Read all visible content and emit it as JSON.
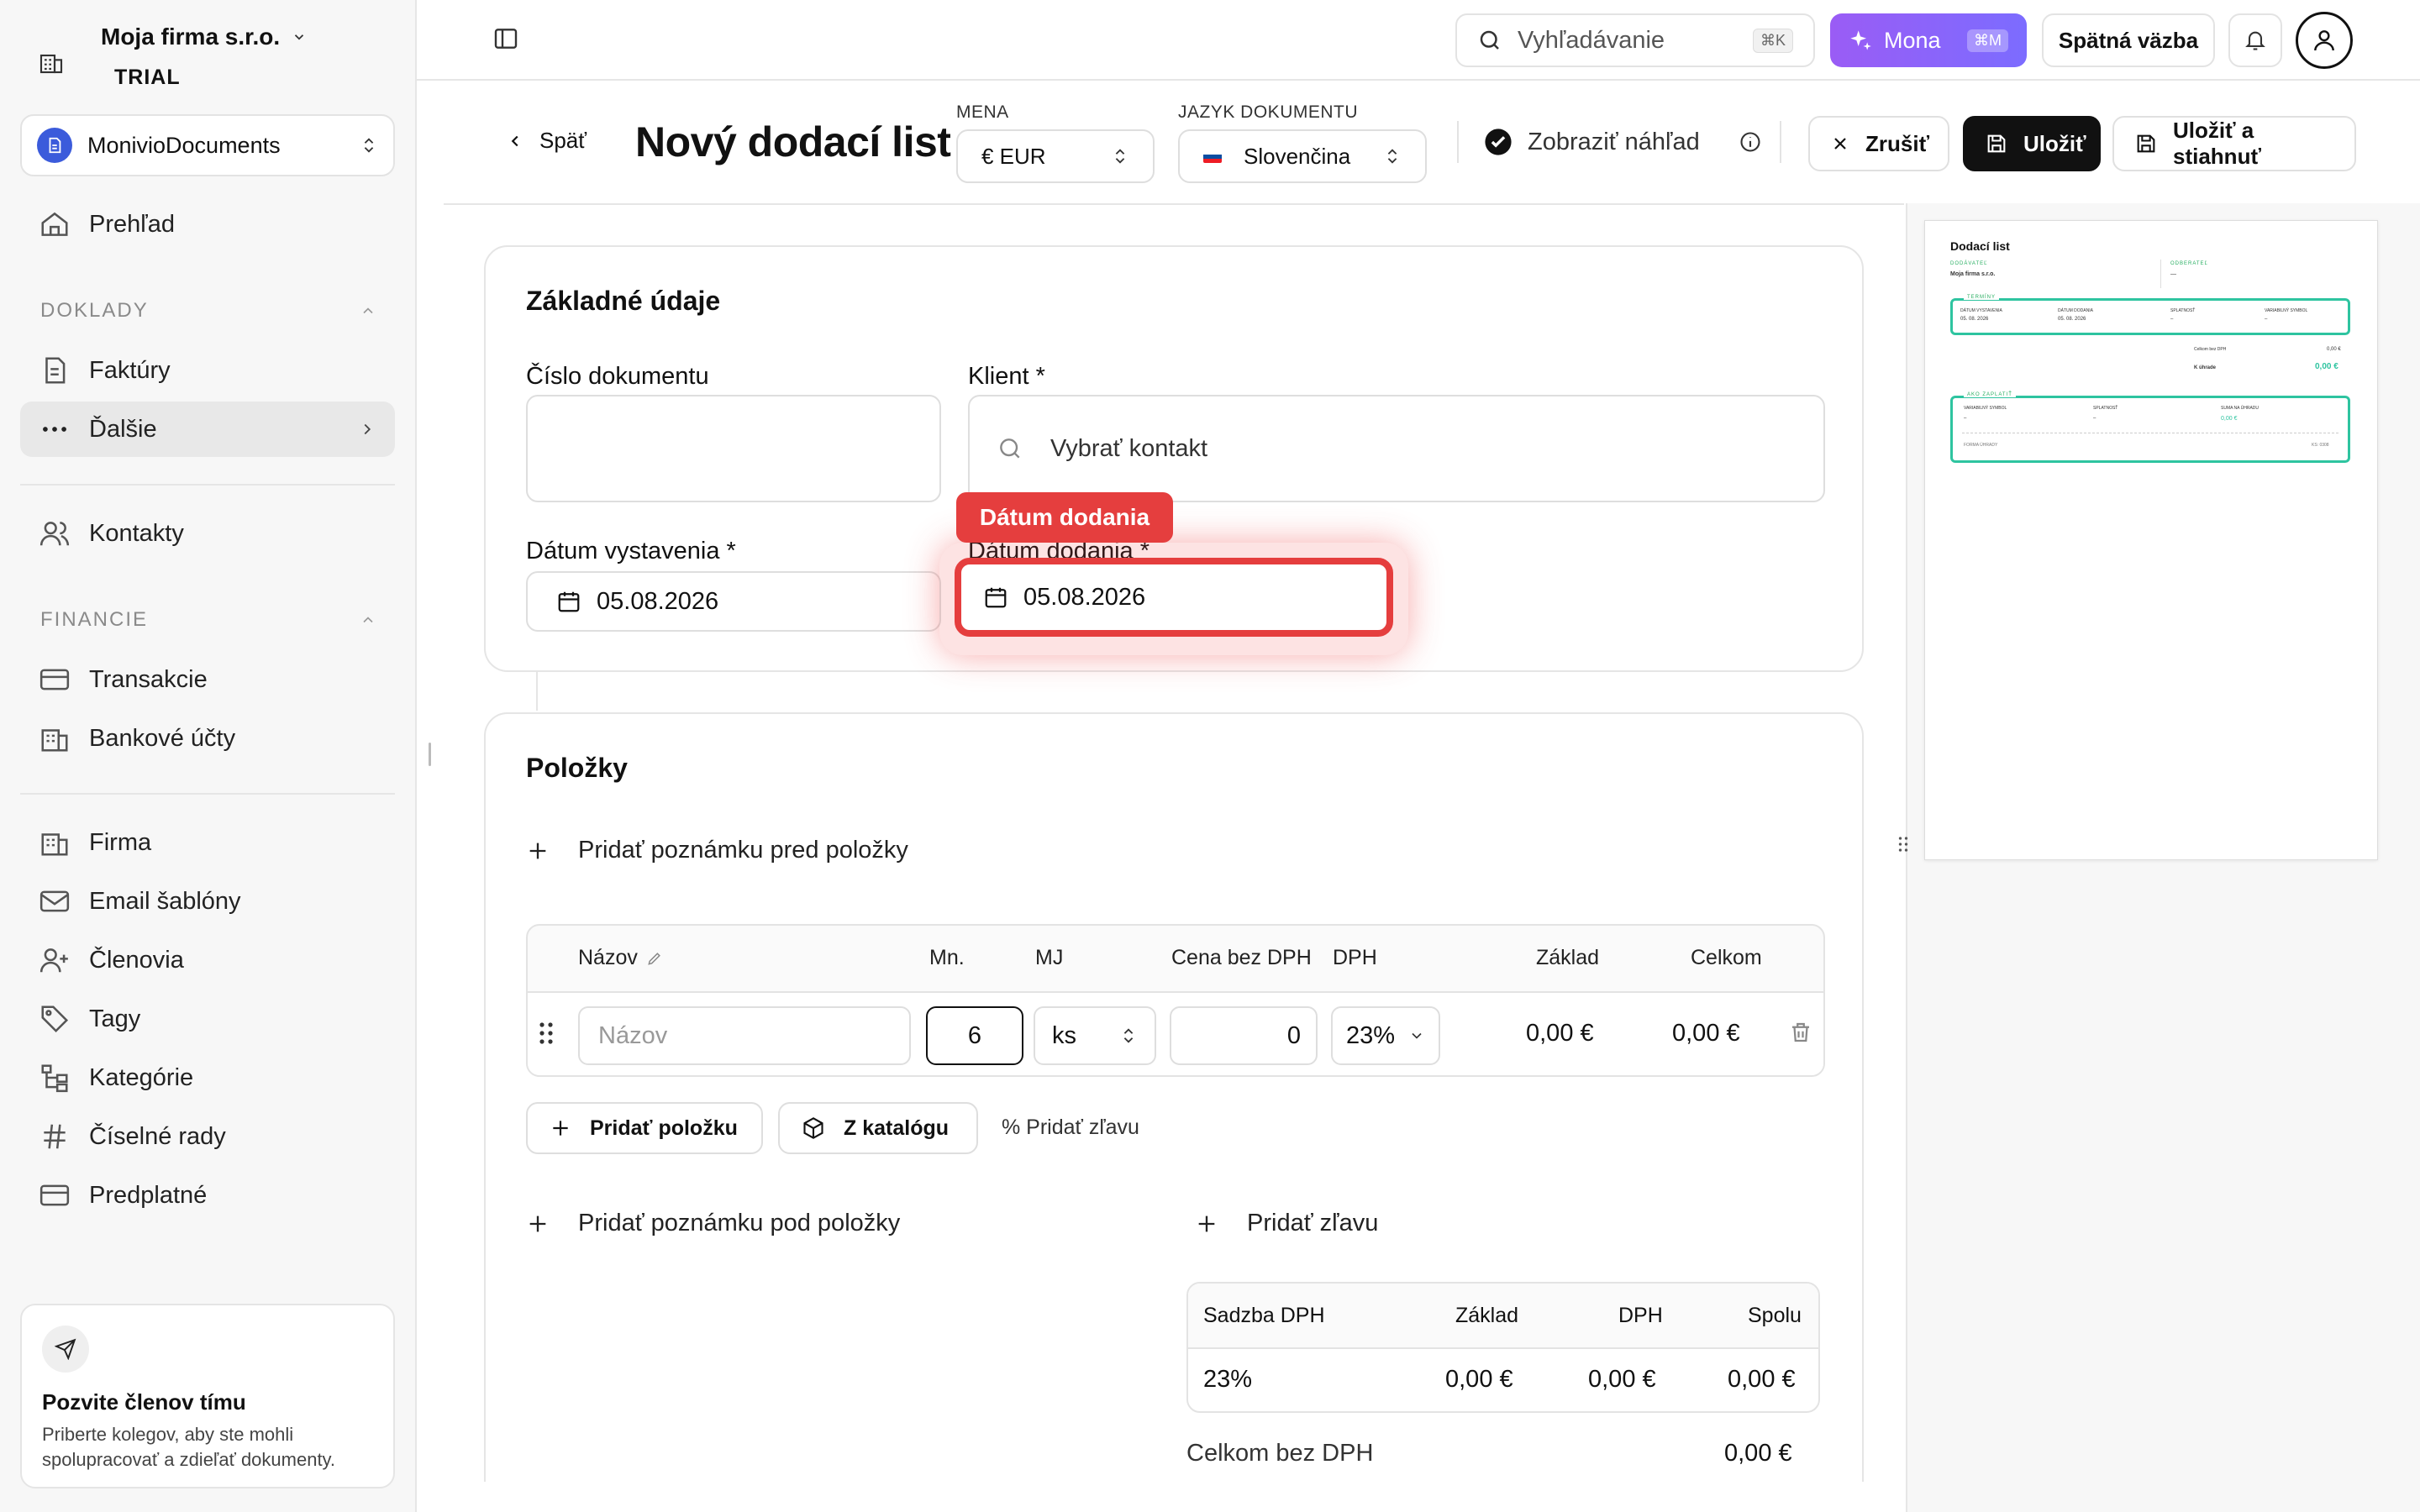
{
  "sidebar": {
    "org_name": "Moja firma s.r.o.",
    "org_plan": "TRIAL",
    "app": "MonivioDocuments",
    "items": {
      "overview": "Prehľad",
      "section_docs": "DOKLADY",
      "invoices": "Faktúry",
      "more": "Ďalšie",
      "contacts": "Kontakty",
      "section_finance": "FINANCIE",
      "transactions": "Transakcie",
      "bank_accounts": "Bankové účty",
      "company": "Firma",
      "email_templates": "Email šablóny",
      "members": "Členovia",
      "tags": "Tagy",
      "categories": "Kategórie",
      "number_series": "Číselné rady",
      "subscription": "Predplatné"
    },
    "invite": {
      "title": "Pozvite členov tímu",
      "text": "Priberte kolegov, aby ste mohli spolupracovať a zdieľať dokumenty."
    }
  },
  "topbar": {
    "search_placeholder": "Vyhľadávanie",
    "search_kbd": "⌘K",
    "mona": "Mona",
    "mona_kbd": "⌘M",
    "feedback": "Spätná väzba"
  },
  "header": {
    "back": "Späť",
    "title": "Nový dodací list",
    "currency_label": "MENA",
    "currency_value": "€ EUR",
    "lang_label": "JAZYK DOKUMENTU",
    "lang_value": "Slovenčina",
    "show_preview": "Zobraziť náhľad",
    "cancel": "Zrušiť",
    "save": "Uložiť",
    "save_download": "Uložiť a stiahnuť"
  },
  "basic": {
    "title": "Základné údaje",
    "doc_number_label": "Číslo dokumentu",
    "doc_number_value": "",
    "client_label": "Klient *",
    "client_placeholder": "Vybrať kontakt",
    "issue_date_label": "Dátum vystavenia *",
    "issue_date_value": "05.08.2026",
    "delivery_date_label": "Dátum dodania *",
    "delivery_date_value": "05.08.2026",
    "tooltip": "Dátum dodania"
  },
  "items": {
    "title": "Položky",
    "add_note_before": "Pridať poznámku pred položky",
    "columns": [
      "Názov",
      "Mn.",
      "MJ",
      "Cena bez DPH",
      "DPH",
      "Základ",
      "Celkom"
    ],
    "row": {
      "name_placeholder": "Názov",
      "qty": "6",
      "unit": "ks",
      "price": "0",
      "vat": "23%",
      "base": "0,00 €",
      "total": "0,00 €"
    },
    "add_item": "Pridať položku",
    "from_catalog": "Z katalógu",
    "add_discount_small": "% Pridať zľavu",
    "add_note_after": "Pridať poznámku pod položky",
    "add_discount": "Pridať zľavu"
  },
  "vat_table": {
    "headers": [
      "Sadzba DPH",
      "Základ",
      "DPH",
      "Spolu"
    ],
    "row": [
      "23%",
      "0,00 €",
      "0,00 €",
      "0,00 €"
    ],
    "total_label": "Celkom bez DPH",
    "total_value": "0,00 €"
  },
  "preview": {
    "title": "Dodací list",
    "supplier_label": "DODÁVATEĽ",
    "supplier_name": "Moja firma s.r.o.",
    "customer_label": "ODBERATEĽ",
    "customer_value": "—",
    "terms_label": "TERMÍNY",
    "issue_label": "DÁTUM VYSTAVENIA",
    "issue_value": "05. 08. 2026",
    "delivery_label": "DÁTUM DODANIA",
    "delivery_value": "05. 08. 2026",
    "due_label": "SPLATNOSŤ",
    "due_value": "–",
    "vs_label": "VARIABILNÝ SYMBOL",
    "vs_value": "–",
    "total_novat_label": "Celkom bez DPH",
    "total_novat_value": "0,00 €",
    "to_pay_label": "K úhrade",
    "to_pay_value": "0,00 €",
    "pay_label": "AKO ZAPLATIŤ",
    "pay_vs_label": "VARIABILNÝ SYMBOL",
    "pay_vs_value": "–",
    "pay_due_label": "SPLATNOSŤ",
    "pay_due_value": "–",
    "pay_sum_label": "SUMA NA ÚHRADU",
    "pay_sum_value": "0,00 €",
    "pay_method": "FORMA ÚHRADY",
    "ks": "KS: 0308"
  },
  "colors": {
    "accent": "#111111",
    "mona": "#8b5cf6",
    "highlight": "#e53e3e",
    "preview_green": "#2ec4a0"
  }
}
